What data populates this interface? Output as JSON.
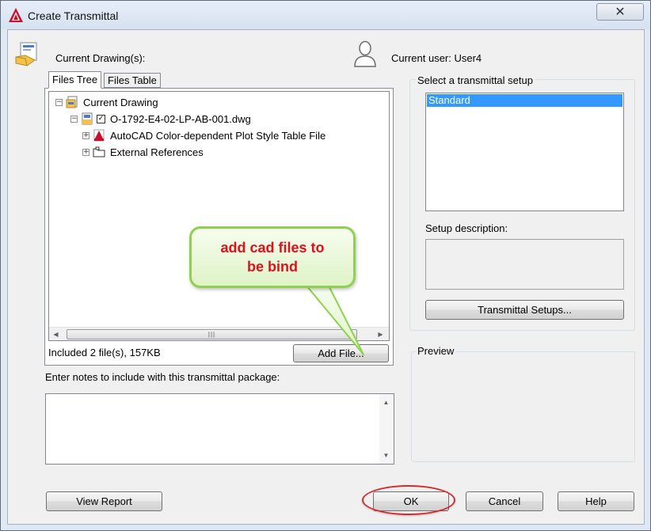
{
  "window": {
    "title": "Create Transmittal"
  },
  "header": {
    "current_drawings_label": "Current Drawing(s):",
    "current_user_label": "Current user: User4"
  },
  "tabs": [
    {
      "label": "Files Tree",
      "active": true
    },
    {
      "label": "Files Table",
      "active": false
    }
  ],
  "tree": {
    "root": "Current Drawing",
    "drawing": "O-1792-E4-02-LP-AB-001.dwg",
    "children": [
      "AutoCAD Color-dependent Plot Style Table File",
      "External References"
    ]
  },
  "files_summary": "Included 2 file(s), 157KB",
  "add_file_button": "Add File...",
  "notes_label": "Enter notes to include with this transmittal package:",
  "notes_value": "",
  "setup": {
    "group_label": "Select a transmittal setup",
    "items": [
      "Standard"
    ],
    "selected": "Standard",
    "description_label": "Setup description:",
    "description_value": "",
    "setups_button": "Transmittal Setups..."
  },
  "preview_label": "Preview",
  "callout": {
    "text": "add cad files to be bind",
    "color": "#e0101b"
  },
  "buttons": {
    "view_report": "View Report",
    "ok": "OK",
    "cancel": "Cancel",
    "help": "Help"
  },
  "colors": {
    "selection": "#3399ff",
    "callout_fill": "#e9f8d7",
    "callout_border": "#8fd14f",
    "ok_highlight": "#d62b2b"
  }
}
